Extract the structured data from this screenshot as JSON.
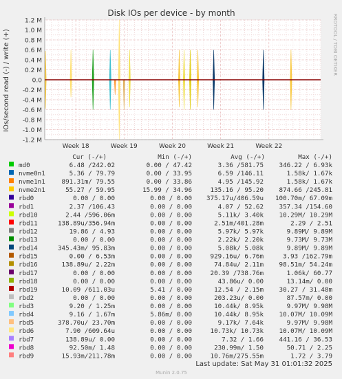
{
  "chart_data": {
    "type": "line",
    "title": "Disk IOs per device - by month",
    "ylabel": "IOs/second read (-) / write (+)",
    "side_label": "RRDTOOL / TOBI OETIKER",
    "ylim": [
      -1.2,
      1.2
    ],
    "y_unit": "M",
    "y_ticks": [
      {
        "v": 1.2,
        "label": "1.2 M"
      },
      {
        "v": 1.0,
        "label": "1.0 M"
      },
      {
        "v": 0.8,
        "label": "0.8 M"
      },
      {
        "v": 0.6,
        "label": "0.6 M"
      },
      {
        "v": 0.4,
        "label": "0.4 M"
      },
      {
        "v": 0.2,
        "label": "0.2 M"
      },
      {
        "v": 0.0,
        "label": "0.0"
      },
      {
        "v": -0.2,
        "label": "-0.2 M"
      },
      {
        "v": -0.4,
        "label": "-0.4 M"
      },
      {
        "v": -0.6,
        "label": "-0.6 M"
      },
      {
        "v": -0.8,
        "label": "-0.8 M"
      },
      {
        "v": -1.0,
        "label": "-1.0 M"
      },
      {
        "v": -1.2,
        "label": "-1.2 M"
      }
    ],
    "x_range": [
      0,
      40
    ],
    "x_ticks": [
      {
        "x": 4.5,
        "label": "Week 18"
      },
      {
        "x": 11.5,
        "label": "Week 19"
      },
      {
        "x": 18.5,
        "label": "Week 20"
      },
      {
        "x": 25.5,
        "label": "Week 21"
      },
      {
        "x": 32.5,
        "label": "Week 22"
      }
    ],
    "spikes": [
      {
        "x": 0.1,
        "top": 0.58,
        "bottom": -0.58,
        "color": "#f8c840"
      },
      {
        "x": 3.8,
        "top": 0.6,
        "bottom": -0.35,
        "color": "#ffe070"
      },
      {
        "x": 7.0,
        "top": 0.6,
        "bottom": -0.6,
        "color": "#21a021"
      },
      {
        "x": 9.5,
        "top": 0.6,
        "bottom": -0.6,
        "color": "#40c0d0"
      },
      {
        "x": 10.2,
        "top": 0.0,
        "bottom": -0.3,
        "color": "#ffa040"
      },
      {
        "x": 10.8,
        "top": 1.2,
        "bottom": -1.2,
        "color": "#ffe070"
      },
      {
        "x": 11.5,
        "top": 0.0,
        "bottom": -0.6,
        "color": "#e0b060"
      },
      {
        "x": 12.3,
        "top": 0.6,
        "bottom": -0.55,
        "color": "#f0e050"
      },
      {
        "x": 19.5,
        "top": 0.6,
        "bottom": -0.55,
        "color": "#f8c840"
      },
      {
        "x": 20.2,
        "top": 0.6,
        "bottom": -0.6,
        "color": "#f0e050"
      },
      {
        "x": 21.1,
        "top": 0.6,
        "bottom": -0.6,
        "color": "#e0d020"
      },
      {
        "x": 22.2,
        "top": 0.6,
        "bottom": -0.55,
        "color": "#f8c840"
      },
      {
        "x": 24.5,
        "top": 0.6,
        "bottom": -0.6,
        "color": "#0c3a6a"
      },
      {
        "x": 31.7,
        "top": 0.6,
        "bottom": -0.6,
        "color": "#0c3a6a"
      },
      {
        "x": 35.7,
        "top": 0.6,
        "bottom": -0.6,
        "color": "#f8c840"
      }
    ]
  },
  "legend": {
    "headers": {
      "cur": "Cur (-/+)",
      "min": "Min (-/+)",
      "avg": "Avg (-/+)",
      "max": "Max (-/+)"
    },
    "rows": [
      {
        "name": "md0",
        "color": "#00cc00",
        "cur": "6.48 /242.02",
        "min": "0.00 / 47.42",
        "avg": "3.36 /581.75",
        "max": "346.22 /  6.93k"
      },
      {
        "name": "nvme0n1",
        "color": "#0066b3",
        "cur": "5.36 / 79.79",
        "min": "0.00 / 33.95",
        "avg": "6.59 /146.11",
        "max": "1.58k/  1.67k"
      },
      {
        "name": "nvme1n1",
        "color": "#ff8000",
        "cur": "891.31m/ 79.55",
        "min": "0.00 / 33.86",
        "avg": "4.95 /145.92",
        "max": "1.58k/  1.67k"
      },
      {
        "name": "nvme2n1",
        "color": "#ffcc00",
        "cur": "55.27 / 59.95",
        "min": "15.99 / 34.96",
        "avg": "135.16 / 95.20",
        "max": "874.66 /245.81"
      },
      {
        "name": "rbd0",
        "color": "#330099",
        "cur": "0.00 /  0.00",
        "min": "0.00 /  0.00",
        "avg": "375.17u/406.59u",
        "max": "100.70m/ 67.09m"
      },
      {
        "name": "rbd1",
        "color": "#990099",
        "cur": "2.37 /106.43",
        "min": "0.00 /  0.00",
        "avg": "4.07 / 52.62",
        "max": "357.34 /154.60"
      },
      {
        "name": "rbd10",
        "color": "#ccff00",
        "cur": "2.44 /596.06m",
        "min": "0.00 /  0.00",
        "avg": "5.11k/  3.40k",
        "max": "10.29M/ 10.29M"
      },
      {
        "name": "rbd11",
        "color": "#ff0000",
        "cur": "138.89u/356.94m",
        "min": "0.00 /  0.00",
        "avg": "2.51m/401.28m",
        "max": "2.29 /  2.51"
      },
      {
        "name": "rbd12",
        "color": "#808080",
        "cur": "19.86 /  4.93",
        "min": "0.00 /  0.00",
        "avg": "5.97k/  5.97k",
        "max": "9.89M/  9.89M"
      },
      {
        "name": "rbd13",
        "color": "#008f00",
        "cur": "0.00 /  0.00",
        "min": "0.00 /  0.00",
        "avg": "2.22k/  2.20k",
        "max": "9.73M/  9.73M"
      },
      {
        "name": "rbd14",
        "color": "#00487d",
        "cur": "345.43m/ 95.83m",
        "min": "0.00 /  0.00",
        "avg": "5.08k/  5.08k",
        "max": "9.89M/  9.89M"
      },
      {
        "name": "rbd15",
        "color": "#b35a00",
        "cur": "0.00 /  6.53m",
        "min": "0.00 /  0.00",
        "avg": "929.16u/  6.76m",
        "max": "3.93 /162.79m"
      },
      {
        "name": "rbd16",
        "color": "#b38f00",
        "cur": "138.89u/  2.22m",
        "min": "0.00 /  0.00",
        "avg": "74.84u/  2.11m",
        "max": "98.51m/ 54.24m"
      },
      {
        "name": "rbd17",
        "color": "#6b006b",
        "cur": "0.00 /  0.00",
        "min": "0.00 /  0.00",
        "avg": "20.39 /738.76m",
        "max": "1.06k/ 60.77"
      },
      {
        "name": "rbd18",
        "color": "#8fb300",
        "cur": "0.00 /  0.00",
        "min": "0.00 /  0.00",
        "avg": "43.86u/  0.00",
        "max": "13.14m/  0.00"
      },
      {
        "name": "rbd19",
        "color": "#b30000",
        "cur": "10.09 /611.03u",
        "min": "5.41 /  0.00",
        "avg": "12.54 /  2.15m",
        "max": "30.27 / 31.48m"
      },
      {
        "name": "rbd2",
        "color": "#bebebe",
        "cur": "0.00 /  0.00",
        "min": "0.00 /  0.00",
        "avg": "203.23u/  0.00",
        "max": "87.57m/  0.00"
      },
      {
        "name": "rbd3",
        "color": "#80ff80",
        "cur": "9.20 /  1.25m",
        "min": "0.00 /  0.00",
        "avg": "10.44k/  8.95k",
        "max": "9.97M/  9.98M"
      },
      {
        "name": "rbd4",
        "color": "#80c9ff",
        "cur": "9.16 /  1.67m",
        "min": "5.86m/  0.00",
        "avg": "10.44k/  8.95k",
        "max": "10.07M/ 10.09M"
      },
      {
        "name": "rbd5",
        "color": "#ffc080",
        "cur": "378.70u/ 23.70m",
        "min": "0.00 /  0.00",
        "avg": "9.17k/  7.64k",
        "max": "9.97M/  9.98M"
      },
      {
        "name": "rbd6",
        "color": "#ffe680",
        "cur": "7.90 /609.64u",
        "min": "0.00 /  0.00",
        "avg": "10.73k/ 10.73k",
        "max": "10.07M/ 10.09M"
      },
      {
        "name": "rbd7",
        "color": "#aa80ff",
        "cur": "138.89u/  0.00",
        "min": "0.00 /  0.00",
        "avg": "7.32 /  1.66",
        "max": "441.16 / 36.53"
      },
      {
        "name": "rbd8",
        "color": "#ee00cc",
        "cur": "92.50m/  1.48",
        "min": "0.00 /  0.00",
        "avg": "230.99m/  1.50",
        "max": "50.71 /  2.25"
      },
      {
        "name": "rbd9",
        "color": "#ff8080",
        "cur": "15.93m/211.78m",
        "min": "0.00 /  0.00",
        "avg": "10.76m/275.55m",
        "max": "1.72 /  3.79"
      }
    ]
  },
  "footer": {
    "last_update": "Last update: Sat May 31 01:01:32 2025",
    "version": "Munin 2.0.75"
  }
}
